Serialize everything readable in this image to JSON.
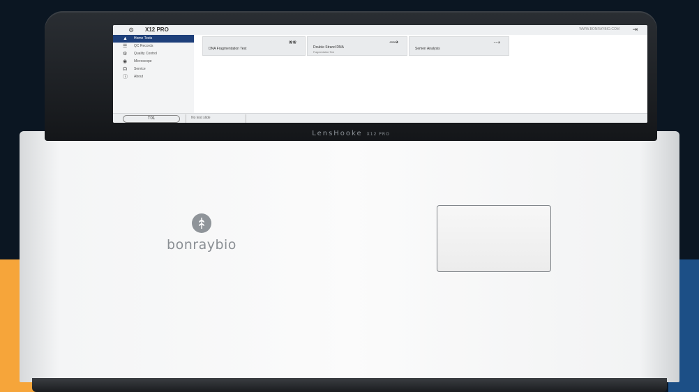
{
  "brand": {
    "logo_text": "bonraybio",
    "device_name": "LensHooke",
    "device_model": "X12 PRO"
  },
  "screen": {
    "app_title": "X12 PRO",
    "user_text": "WWW.BONRAYBIO.COM",
    "nav": [
      {
        "label": "Home Tests",
        "icon": "home-icon",
        "glyph": "▲"
      },
      {
        "label": "QC Records",
        "icon": "records-icon",
        "glyph": "☰"
      },
      {
        "label": "Quality Control",
        "icon": "quality-icon",
        "glyph": "⚙"
      },
      {
        "label": "Microscope",
        "icon": "microscope-icon",
        "glyph": "◉"
      },
      {
        "label": "Service",
        "icon": "service-icon",
        "glyph": "☊"
      },
      {
        "label": "About",
        "icon": "about-icon",
        "glyph": "ⓘ"
      }
    ],
    "tiles": [
      {
        "label": "DNA Fragmentation Test",
        "sub": "",
        "icon": "dna-icon",
        "glyph": "⨳⨳"
      },
      {
        "label": "Double Strand DNA",
        "sub": "Fragmentation Test",
        "icon": "double-dna-icon",
        "glyph": "⟿"
      },
      {
        "label": "Semen Analysis",
        "icon": "sperm-icon",
        "glyph": "⤏",
        "sub": ""
      }
    ],
    "status": {
      "pill": "T01",
      "message": "No test slide"
    }
  }
}
